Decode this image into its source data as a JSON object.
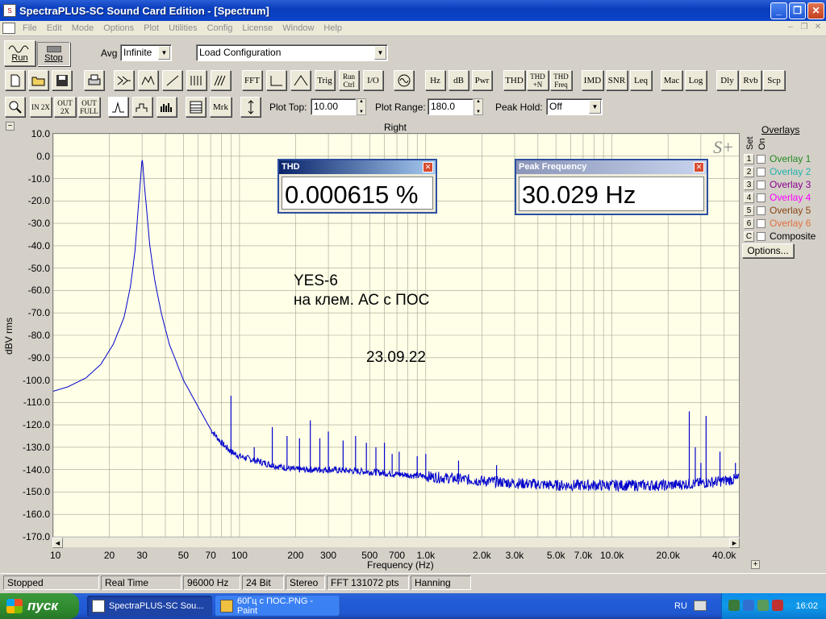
{
  "window": {
    "title": "SpectraPLUS-SC Sound Card Edition - [Spectrum]",
    "app_icon": "spectraplus-app-icon",
    "controls": {
      "minimize": "_",
      "maximize": "❐",
      "close": "✕"
    }
  },
  "menu": {
    "items": [
      "File",
      "Edit",
      "Mode",
      "Options",
      "Plot",
      "Utilities",
      "Config",
      "License",
      "Window",
      "Help"
    ],
    "mdi_controls": {
      "minimize": "–",
      "restore": "❐",
      "close": "✕"
    }
  },
  "toolbar1": {
    "run_label": "Run",
    "stop_label": "Stop",
    "avg_label": "Avg",
    "avg_value": "Infinite",
    "config_value": "Load Configuration"
  },
  "toolbar2": {
    "buttons": [
      "FFT",
      "Trig",
      "Run Ctrl",
      "I/O",
      "Hz",
      "dB",
      "Pwr",
      "THD",
      "THD +N",
      "THD Freq",
      "IMD",
      "SNR",
      "Leq",
      "Mac",
      "Log",
      "Dly",
      "Rvb",
      "Scp"
    ]
  },
  "toolbar3": {
    "zoom_in_label": "IN 2X",
    "zoom_out_label": "OUT 2X",
    "zoom_full_label": "OUT FULL",
    "mrk_label": "Mrk",
    "plot_top_label": "Plot Top:",
    "plot_top_value": "10.00",
    "plot_range_label": "Plot Range:",
    "plot_range_value": "180.0",
    "peak_hold_label": "Peak Hold:",
    "peak_hold_value": "Off"
  },
  "plot": {
    "channel": "Right",
    "ylabel": "dBV rms",
    "xlabel": "Frequency (Hz)",
    "logo": "S+",
    "collapse_glyph": "−",
    "expand_glyph": "+",
    "annotation_line1": "YES-6",
    "annotation_line2": "на клем. АС с ПОС",
    "annotation_date": "23.09.22"
  },
  "chart_data": {
    "type": "line",
    "xscale": "log",
    "xlim": [
      10,
      48000
    ],
    "ylim": [
      -170,
      10
    ],
    "yticks": [
      "10.0",
      "0.0",
      "-10.0",
      "-20.0",
      "-30.0",
      "-40.0",
      "-50.0",
      "-60.0",
      "-70.0",
      "-80.0",
      "-90.0",
      "-100.0",
      "-110.0",
      "-120.0",
      "-130.0",
      "-140.0",
      "-150.0",
      "-160.0",
      "-170.0"
    ],
    "xticks": [
      {
        "v": 10,
        "t": "10"
      },
      {
        "v": 20,
        "t": "20"
      },
      {
        "v": 30,
        "t": "30"
      },
      {
        "v": 50,
        "t": "50"
      },
      {
        "v": 70,
        "t": "70"
      },
      {
        "v": 100,
        "t": "100"
      },
      {
        "v": 200,
        "t": "200"
      },
      {
        "v": 300,
        "t": "300"
      },
      {
        "v": 500,
        "t": "500"
      },
      {
        "v": 700,
        "t": "700"
      },
      {
        "v": 1000,
        "t": "1.0k"
      },
      {
        "v": 2000,
        "t": "2.0k"
      },
      {
        "v": 3000,
        "t": "3.0k"
      },
      {
        "v": 5000,
        "t": "5.0k"
      },
      {
        "v": 7000,
        "t": "7.0k"
      },
      {
        "v": 10000,
        "t": "10.0k"
      },
      {
        "v": 20000,
        "t": "20.0k"
      },
      {
        "v": 40000,
        "t": "40.0k"
      }
    ],
    "series": [
      {
        "color": "#0000cc",
        "points": [
          [
            10,
            -105
          ],
          [
            12,
            -103
          ],
          [
            15,
            -99
          ],
          [
            18,
            -93
          ],
          [
            21,
            -84
          ],
          [
            24,
            -72
          ],
          [
            26,
            -58
          ],
          [
            27.5,
            -42
          ],
          [
            28.5,
            -25
          ],
          [
            29.3,
            -12
          ],
          [
            29.8,
            -4
          ],
          [
            30,
            -1
          ],
          [
            30.3,
            -4
          ],
          [
            30.8,
            -12
          ],
          [
            31.8,
            -25
          ],
          [
            33,
            -40
          ],
          [
            35,
            -55
          ],
          [
            38,
            -70
          ],
          [
            42,
            -84
          ],
          [
            50,
            -100
          ],
          [
            60,
            -112
          ],
          [
            70,
            -122
          ],
          [
            80,
            -128
          ],
          [
            90,
            -132
          ],
          [
            100,
            -134
          ],
          [
            150,
            -138
          ],
          [
            200,
            -140
          ],
          [
            300,
            -140
          ],
          [
            500,
            -141
          ],
          [
            700,
            -142
          ],
          [
            1000,
            -143
          ],
          [
            2000,
            -145
          ],
          [
            3000,
            -146
          ],
          [
            5000,
            -147
          ],
          [
            7000,
            -147
          ],
          [
            10000,
            -147
          ],
          [
            20000,
            -147
          ],
          [
            30000,
            -146
          ],
          [
            40000,
            -145
          ],
          [
            48000,
            -144
          ]
        ],
        "spikes": [
          [
            90,
            -107
          ],
          [
            120,
            -130
          ],
          [
            150,
            -121
          ],
          [
            180,
            -125
          ],
          [
            210,
            -126
          ],
          [
            240,
            -118
          ],
          [
            270,
            -126
          ],
          [
            300,
            -123
          ],
          [
            360,
            -127
          ],
          [
            420,
            -125
          ],
          [
            480,
            -128
          ],
          [
            540,
            -130
          ],
          [
            600,
            -128
          ],
          [
            660,
            -133
          ],
          [
            720,
            -132
          ],
          [
            900,
            -134
          ],
          [
            1000,
            -133
          ],
          [
            1500,
            -136
          ],
          [
            2400,
            -138
          ],
          [
            26000,
            -114
          ],
          [
            28000,
            -130
          ],
          [
            30000,
            -137
          ],
          [
            32000,
            -116
          ],
          [
            38000,
            -132
          ],
          [
            46000,
            -137
          ]
        ]
      }
    ]
  },
  "meters": {
    "thd": {
      "title": "THD",
      "value": "0.000615 %",
      "close": "✕"
    },
    "peak": {
      "title": "Peak Frequency",
      "value": "30.029 Hz",
      "close": "✕"
    }
  },
  "overlays": {
    "title": "Overlays",
    "set_label": "Set",
    "on_label": "On",
    "rows": [
      {
        "set": "1",
        "label": "Overlay 1",
        "color": "#228b22"
      },
      {
        "set": "2",
        "label": "Overlay 2",
        "color": "#20b2aa"
      },
      {
        "set": "3",
        "label": "Overlay 3",
        "color": "#8b008b"
      },
      {
        "set": "4",
        "label": "Overlay 4",
        "color": "#ff00ff"
      },
      {
        "set": "5",
        "label": "Overlay 5",
        "color": "#8b4513"
      },
      {
        "set": "6",
        "label": "Overlay 6",
        "color": "#e07040"
      },
      {
        "set": "C",
        "label": "Composite",
        "color": "#000000"
      }
    ],
    "options_label": "Options..."
  },
  "status": {
    "cells": [
      "Stopped",
      "Real Time",
      "96000 Hz",
      "24 Bit",
      "Stereo",
      "FFT 131072 pts",
      "Hanning"
    ]
  },
  "taskbar": {
    "start_label": "пуск",
    "tasks": [
      {
        "label": "SpectraPLUS-SC Sou..."
      },
      {
        "label": "60Гц с ПОС.PNG - Paint"
      }
    ],
    "lang": "RU",
    "clock": "16:02"
  }
}
